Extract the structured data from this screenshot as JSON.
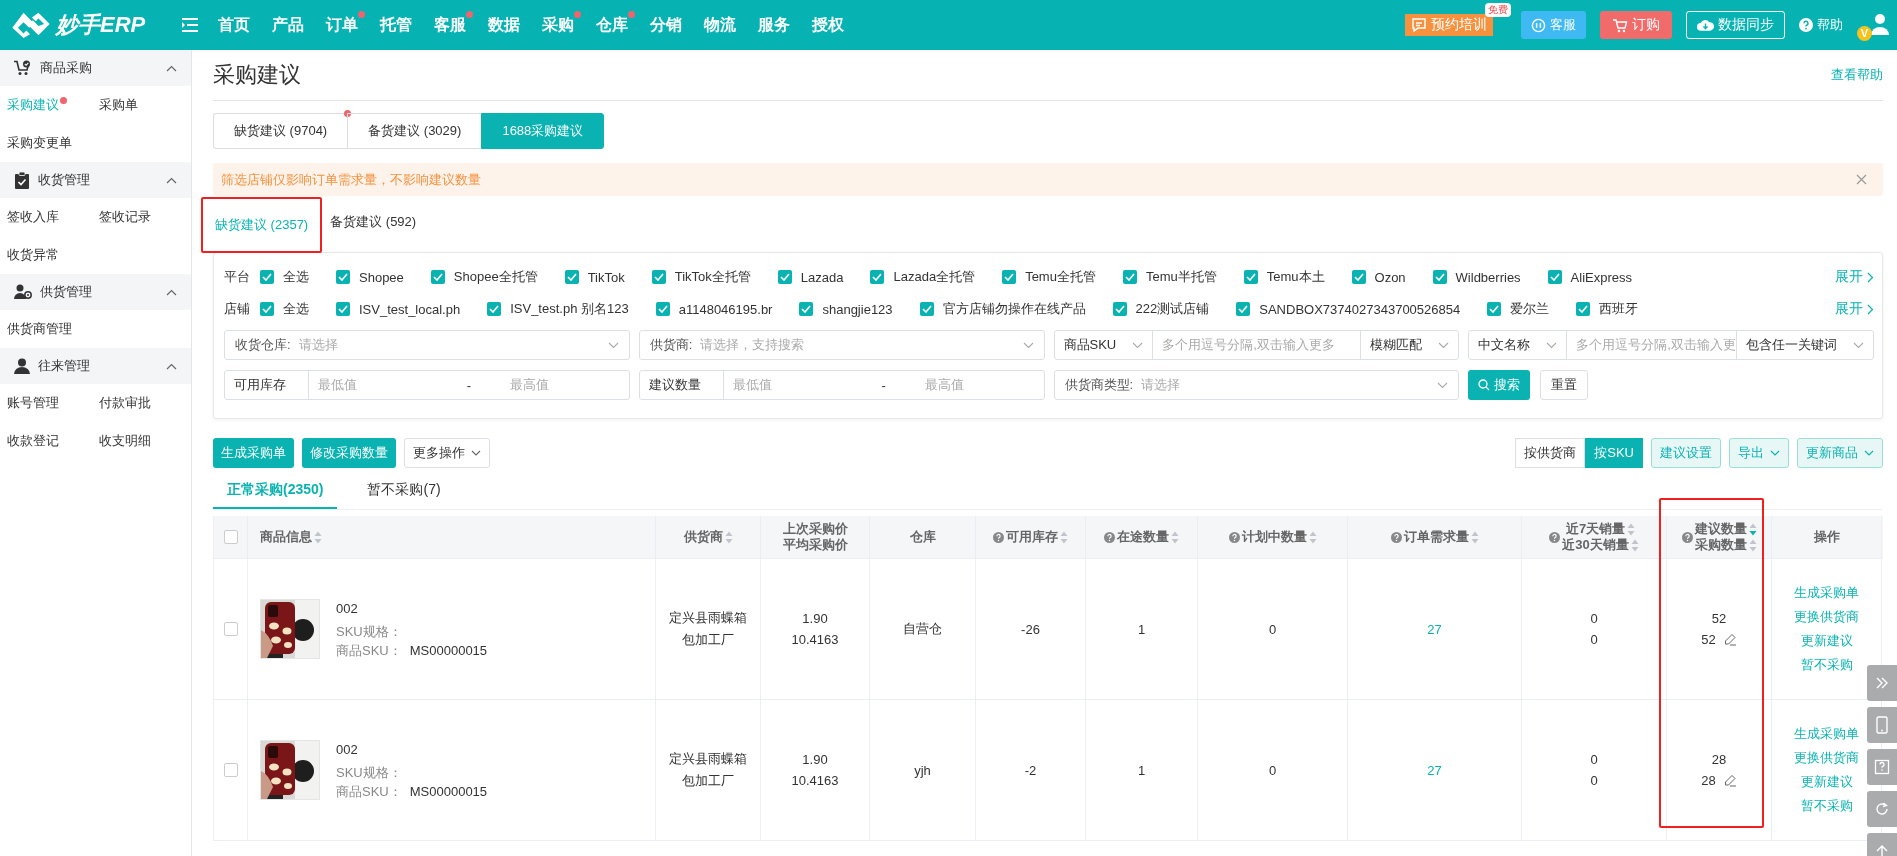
{
  "header": {
    "logo": "妙手ERP",
    "nav": [
      {
        "label": "首页",
        "badge": false
      },
      {
        "label": "产品",
        "badge": false
      },
      {
        "label": "订单",
        "badge": true
      },
      {
        "label": "托管",
        "badge": false
      },
      {
        "label": "客服",
        "badge": true
      },
      {
        "label": "数据",
        "badge": false
      },
      {
        "label": "采购",
        "badge": true
      },
      {
        "label": "仓库",
        "badge": true
      },
      {
        "label": "分销",
        "badge": false
      },
      {
        "label": "物流",
        "badge": false
      },
      {
        "label": "服务",
        "badge": false
      },
      {
        "label": "授权",
        "badge": false
      }
    ],
    "actions": [
      {
        "kind": "training",
        "label": "预约培训",
        "badge": "免费"
      },
      {
        "kind": "service",
        "label": "客服"
      },
      {
        "kind": "order",
        "label": "订购"
      },
      {
        "kind": "sync",
        "label": "数据同步"
      },
      {
        "kind": "help",
        "label": "帮助"
      }
    ],
    "avatar_badge": "V"
  },
  "sidebar": {
    "groups": [
      {
        "title": "商品采购",
        "expanded": true,
        "items": [
          {
            "label": "采购建议",
            "selected": true,
            "badge": true
          },
          {
            "label": "采购单",
            "selected": false,
            "badge": false
          },
          {
            "label": "采购变更单",
            "selected": false,
            "badge": false
          }
        ]
      },
      {
        "title": "收货管理",
        "expanded": true,
        "items": [
          {
            "label": "签收入库",
            "selected": false,
            "badge": false
          },
          {
            "label": "签收记录",
            "selected": false,
            "badge": false
          },
          {
            "label": "收货异常",
            "selected": false,
            "badge": false
          }
        ]
      },
      {
        "title": "供货管理",
        "expanded": true,
        "items": [
          {
            "label": "供货商管理",
            "selected": false,
            "badge": false
          }
        ]
      },
      {
        "title": "往来管理",
        "expanded": true,
        "items": [
          {
            "label": "账号管理",
            "selected": false,
            "badge": false
          },
          {
            "label": "付款审批",
            "selected": false,
            "badge": false
          },
          {
            "label": "收款登记",
            "selected": false,
            "badge": false
          },
          {
            "label": "收支明细",
            "selected": false,
            "badge": false
          }
        ]
      }
    ]
  },
  "page": {
    "title": "采购建议",
    "help_link": "查看帮助"
  },
  "tabs": [
    {
      "label": "缺货建议 (9704)",
      "selected": false,
      "badge": true
    },
    {
      "label": "备货建议 (3029)",
      "selected": false,
      "badge": false
    },
    {
      "label": "1688采购建议",
      "selected": true,
      "badge": false
    }
  ],
  "alert": {
    "text": "筛选店铺仅影响订单需求量，不影响建议数量",
    "closable": true
  },
  "sub_tabs": [
    {
      "label": "缺货建议 (2357)",
      "selected": true,
      "highlighted": true
    },
    {
      "label": "备货建议 (592)",
      "selected": false,
      "highlighted": false
    }
  ],
  "filters": {
    "check_rows": [
      {
        "label": "平台",
        "expand": "展开",
        "options": [
          {
            "label": "全选",
            "checked": true
          },
          {
            "label": "Shopee",
            "checked": true
          },
          {
            "label": "Shopee全托管",
            "checked": true
          },
          {
            "label": "TikTok",
            "checked": true
          },
          {
            "label": "TikTok全托管",
            "checked": true
          },
          {
            "label": "Lazada",
            "checked": true
          },
          {
            "label": "Lazada全托管",
            "checked": true
          },
          {
            "label": "Temu全托管",
            "checked": true
          },
          {
            "label": "Temu半托管",
            "checked": true
          },
          {
            "label": "Temu本土",
            "checked": true
          },
          {
            "label": "Ozon",
            "checked": true
          },
          {
            "label": "Wildberries",
            "checked": true
          },
          {
            "label": "AliExpress",
            "checked": true
          }
        ]
      },
      {
        "label": "店铺",
        "expand": "展开",
        "options": [
          {
            "label": "全选",
            "checked": true
          },
          {
            "label": "ISV_test_local.ph",
            "checked": true
          },
          {
            "label": "ISV_test.ph 别名123",
            "checked": true
          },
          {
            "label": "a1148046195.br",
            "checked": true
          },
          {
            "label": "shangjie123",
            "checked": true
          },
          {
            "label": "官方店铺勿操作在线产品",
            "checked": true
          },
          {
            "label": "222测试店铺",
            "checked": true
          },
          {
            "label": "SANDBOX7374027343700526854",
            "checked": true
          },
          {
            "label": "爱尔兰",
            "checked": true
          },
          {
            "label": "西班牙",
            "checked": true
          }
        ]
      }
    ],
    "fields": [
      {
        "kind": "select",
        "label": "收货仓库:",
        "placeholder": "请选择"
      },
      {
        "kind": "select",
        "label": "供货商:",
        "placeholder": "请选择，支持搜索"
      },
      {
        "kind": "match",
        "type": "商品SKU",
        "placeholder": "多个用逗号分隔,双击输入更多",
        "mode": "模糊匹配"
      },
      {
        "kind": "match",
        "type": "中文名称",
        "placeholder": "多个用逗号分隔,双击输入更",
        "mode": "包含任一关键词"
      },
      {
        "kind": "range",
        "type": "可用库存",
        "min_placeholder": "最低值",
        "separator": "-",
        "max_placeholder": "最高值"
      },
      {
        "kind": "range",
        "type": "建议数量",
        "min_placeholder": "最低值",
        "separator": "-",
        "max_placeholder": "最高值"
      },
      {
        "kind": "select",
        "label": "供货商类型:",
        "placeholder": "请选择"
      }
    ],
    "search_button": "搜索",
    "reset_button": "重置"
  },
  "toolbar": {
    "buttons": [
      {
        "kind": "primary",
        "label": "生成采购单"
      },
      {
        "kind": "primary",
        "label": "修改采购数量"
      },
      {
        "kind": "dropdown",
        "label": "更多操作"
      }
    ],
    "view_toggle": [
      {
        "label": "按供货商",
        "selected": false
      },
      {
        "label": "按SKU",
        "selected": true
      }
    ],
    "right_buttons": [
      {
        "label": "建议设置",
        "dropdown": false
      },
      {
        "label": "导出",
        "dropdown": true
      },
      {
        "label": "更新商品",
        "dropdown": true
      }
    ]
  },
  "table_tabs": [
    {
      "label": "正常采购(2350)",
      "selected": true
    },
    {
      "label": "暂不采购(7)",
      "selected": false
    }
  ],
  "table": {
    "select_all_checked": false,
    "columns": [
      {
        "lines": [
          {
            "text": "商品信息",
            "sortable": true,
            "sort_desc": false
          }
        ],
        "help": false,
        "highlighted": false
      },
      {
        "lines": [
          {
            "text": "供货商",
            "sortable": true,
            "sort_desc": false
          }
        ],
        "help": false,
        "highlighted": false
      },
      {
        "lines": [
          {
            "text": "上次采购价"
          },
          {
            "text": "平均采购价"
          }
        ],
        "help": false,
        "highlighted": false
      },
      {
        "lines": [
          {
            "text": "仓库"
          }
        ],
        "help": false,
        "highlighted": false
      },
      {
        "lines": [
          {
            "text": "可用库存",
            "sortable": true,
            "sort_desc": false
          }
        ],
        "help": true,
        "highlighted": false
      },
      {
        "lines": [
          {
            "text": "在途数量",
            "sortable": true,
            "sort_desc": false
          }
        ],
        "help": true,
        "highlighted": false
      },
      {
        "lines": [
          {
            "text": "计划中数量",
            "sortable": true,
            "sort_desc": false
          }
        ],
        "help": true,
        "highlighted": false
      },
      {
        "lines": [
          {
            "text": "订单需求量",
            "sortable": true,
            "sort_desc": false
          }
        ],
        "help": true,
        "highlighted": false
      },
      {
        "lines": [
          {
            "text": "近7天销量",
            "sortable": true,
            "sort_desc": false
          },
          {
            "text": "近30天销量",
            "sortable": true,
            "sort_desc": false
          }
        ],
        "help": true,
        "highlighted": false
      },
      {
        "lines": [
          {
            "text": "建议数量",
            "sortable": true,
            "sort_desc": true
          },
          {
            "text": "采购数量",
            "sortable": true,
            "sort_desc": false
          }
        ],
        "help": true,
        "highlighted": true
      },
      {
        "lines": [
          {
            "text": "操作"
          }
        ],
        "help": false,
        "highlighted": false
      }
    ],
    "rows": [
      {
        "checked": false,
        "name": "002",
        "spec_label": "SKU规格：",
        "sku_label": "商品SKU：",
        "sku": "MS00000015",
        "supplier": "定兴县雨蝶箱包加工厂",
        "last_price": "1.90",
        "avg_price": "10.4163",
        "warehouse": "自营仓",
        "available": "-26",
        "in_transit": "1",
        "planned": "0",
        "order_demand": "27",
        "sales_7d": "0",
        "sales_30d": "0",
        "suggested": "52",
        "purchase": "52",
        "actions": [
          "生成采购单",
          "更换供货商",
          "更新建议",
          "暂不采购"
        ]
      },
      {
        "checked": false,
        "name": "002",
        "spec_label": "SKU规格：",
        "sku_label": "商品SKU：",
        "sku": "MS00000015",
        "supplier": "定兴县雨蝶箱包加工厂",
        "last_price": "1.90",
        "avg_price": "10.4163",
        "warehouse": "yjh",
        "available": "-2",
        "in_transit": "1",
        "planned": "0",
        "order_demand": "27",
        "sales_7d": "0",
        "sales_30d": "0",
        "suggested": "28",
        "purchase": "28",
        "actions": [
          "生成采购单",
          "更换供货商",
          "更新建议",
          "暂不采购"
        ]
      }
    ]
  }
}
